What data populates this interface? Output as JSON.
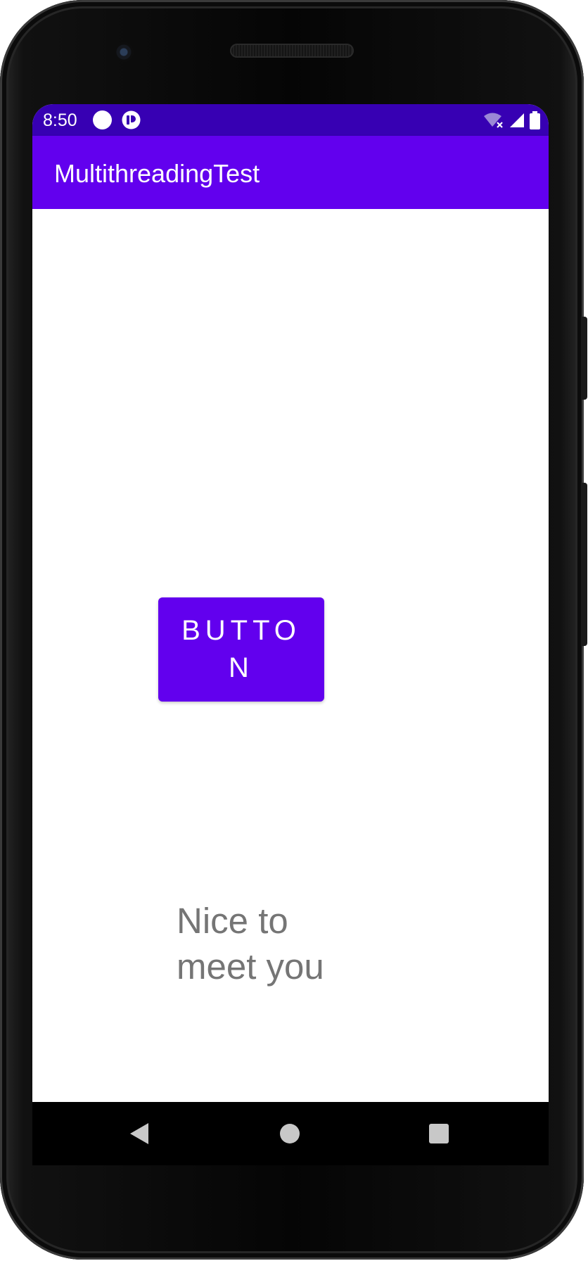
{
  "status_bar": {
    "time": "8:50",
    "icons": [
      "notification-dot-icon",
      "app-notification-icon",
      "wifi-off-icon",
      "cell-signal-icon",
      "battery-icon"
    ],
    "background_color": "#3700b3"
  },
  "app_bar": {
    "title": "MultithreadingTest",
    "background_color": "#6200ee"
  },
  "main": {
    "button_label": "BUTTON",
    "message": "Nice to meet you"
  },
  "nav_bar": {
    "icons": [
      "back-icon",
      "home-icon",
      "recents-icon"
    ]
  },
  "colors": {
    "primary": "#6200ee",
    "primary_dark": "#3700b3",
    "message_text": "#757575"
  }
}
